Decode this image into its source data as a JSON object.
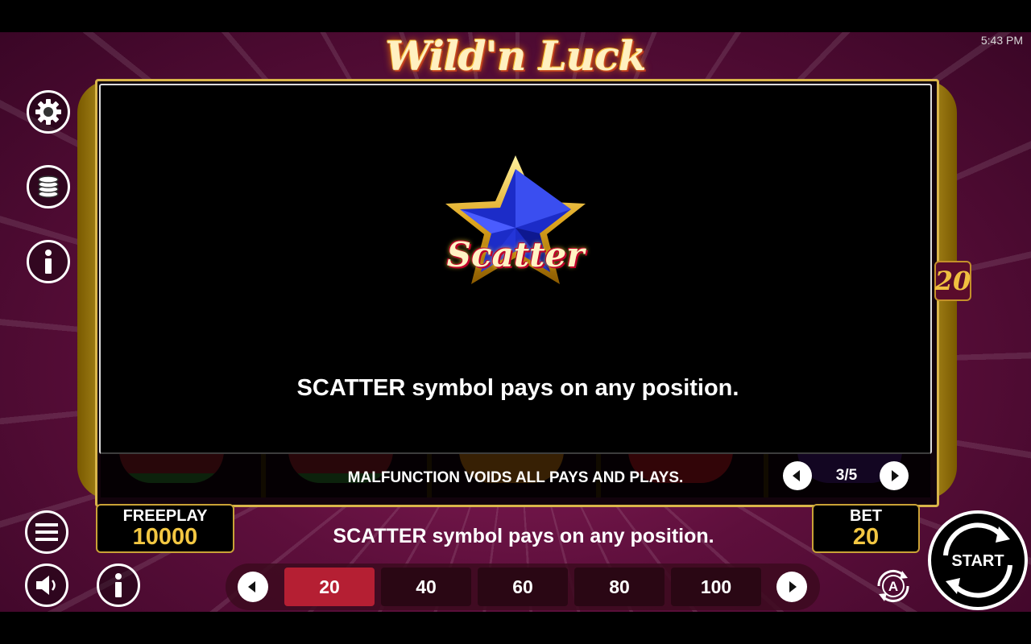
{
  "status_bar": {
    "time": "5:43 PM"
  },
  "game": {
    "title": "Wild'n Luck 20",
    "reel_badge": "20"
  },
  "info_panel": {
    "symbol_label": "Scatter",
    "description": "SCATTER symbol pays on any position."
  },
  "footer_notice": "MALFUNCTION VOIDS ALL PAYS AND PLAYS.",
  "pager": {
    "current": "3/5"
  },
  "freeplay": {
    "label": "FREEPLAY",
    "value": "10000"
  },
  "bet": {
    "label": "BET",
    "value": "20"
  },
  "status_message": "SCATTER symbol pays on any position.",
  "bet_options": [
    "20",
    "40",
    "60",
    "80",
    "100"
  ],
  "selected_bet": "20",
  "start_label": "START",
  "icons": [
    "gear-icon",
    "coins-icon",
    "info-icon",
    "menu-icon",
    "sound-icon",
    "autoplay-icon",
    "chevron-left-icon",
    "chevron-right-icon"
  ],
  "colors": {
    "accent_gold": "#f3c742",
    "active_bet": "#b51f33",
    "background": "#5e0f3c"
  }
}
